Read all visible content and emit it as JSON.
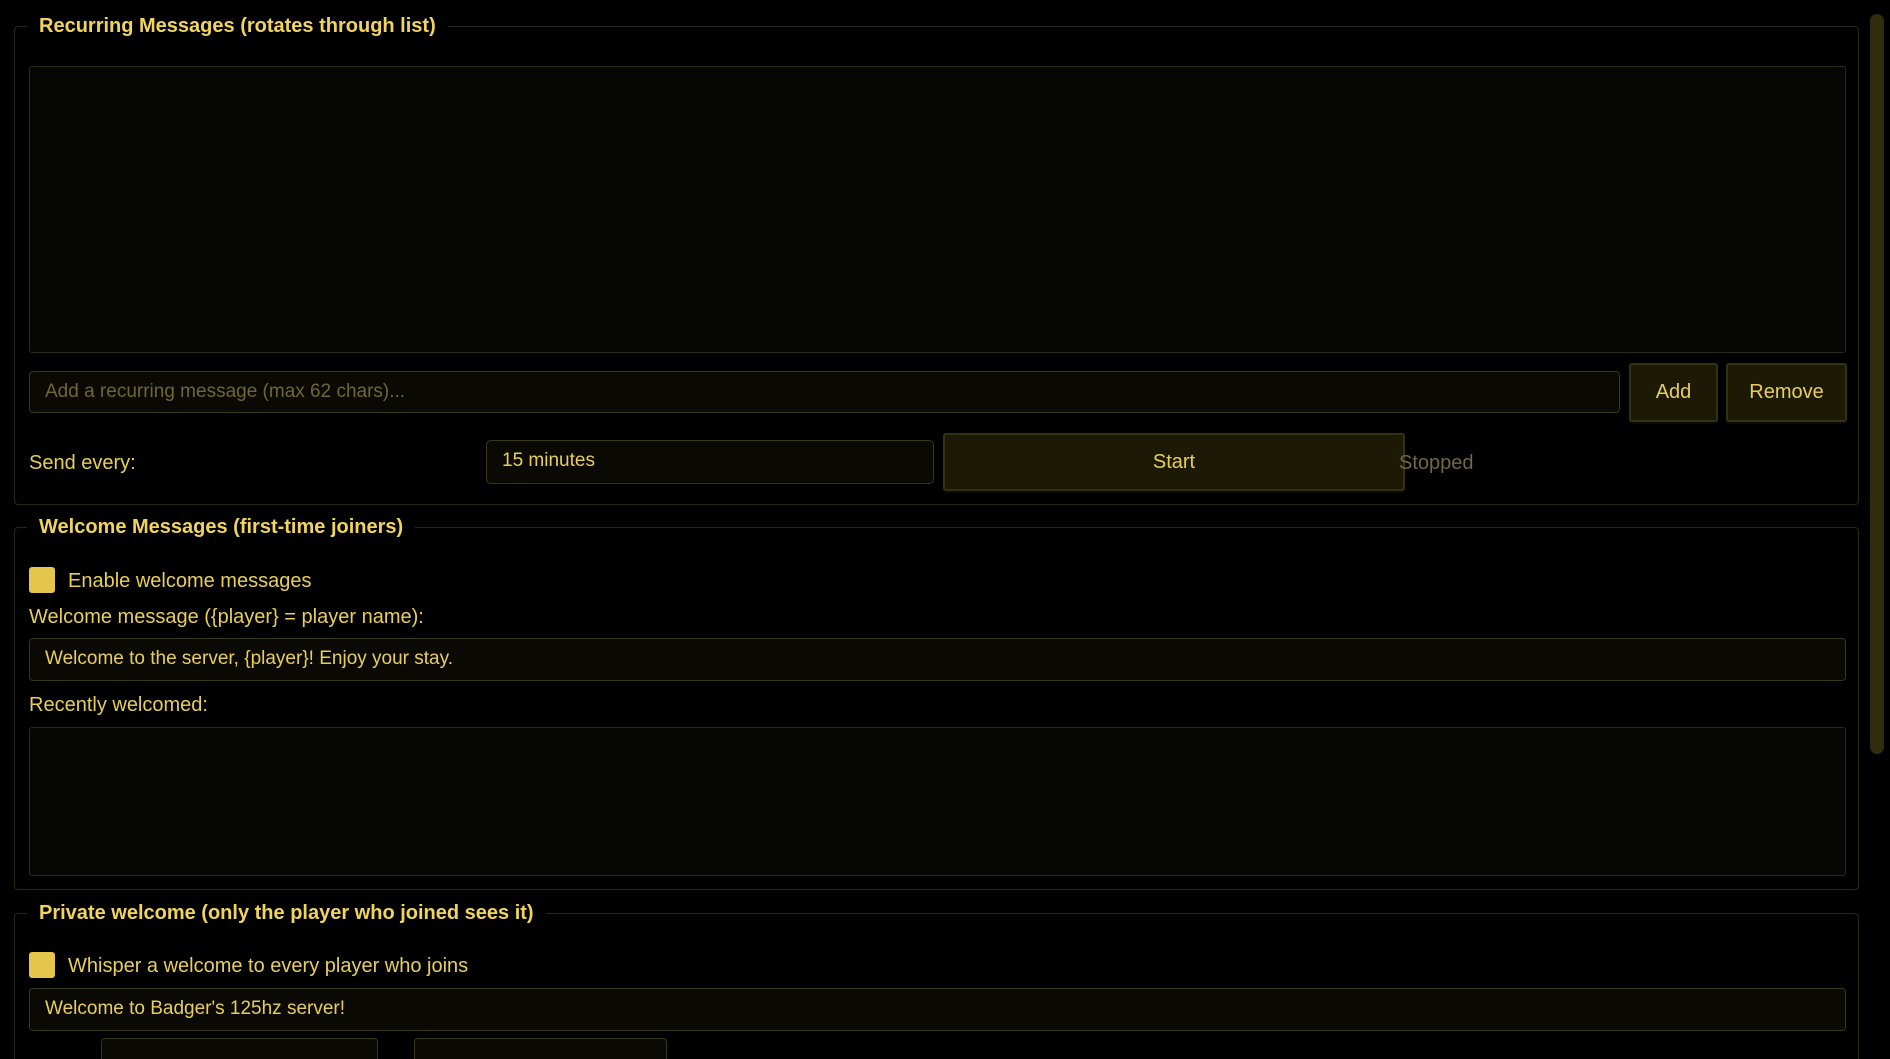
{
  "recurring": {
    "legend": "Recurring Messages (rotates through list)",
    "input_placeholder": "Add a recurring message (max 62 chars)...",
    "add_label": "Add",
    "remove_label": "Remove",
    "send_every_label": "Send every:",
    "interval_value": "15 minutes",
    "start_label": "Start",
    "status": "Stopped"
  },
  "welcome": {
    "legend": "Welcome Messages (first-time joiners)",
    "enable_label": "Enable welcome messages",
    "message_label": "Welcome message ({player} = player name):",
    "message_value": "Welcome to the server, {player}! Enjoy your stay.",
    "recent_label": "Recently welcomed:"
  },
  "private_welcome": {
    "legend": "Private welcome (only the player who joined sees it)",
    "enable_label": "Whisper a welcome to every player who joins",
    "message_value": "Welcome to Badger's 125hz server!"
  },
  "colors": {
    "accent": "#e8cf5a",
    "background": "#000000",
    "checkbox": "#e5c54b"
  }
}
